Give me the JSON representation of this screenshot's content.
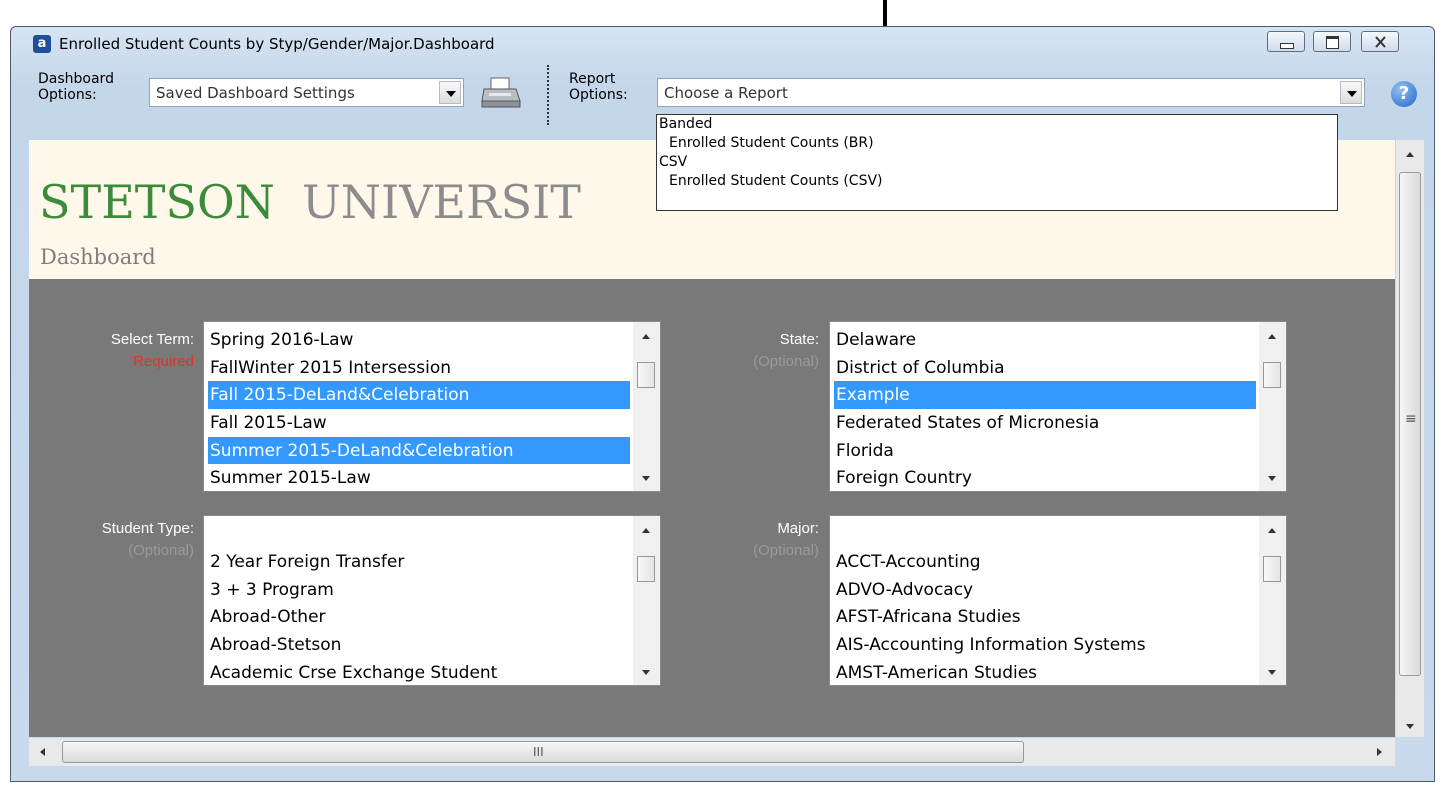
{
  "window": {
    "app_icon_letter": "a",
    "title": "Enrolled Student Counts by Styp/Gender/Major.Dashboard",
    "controls": [
      "minimize-icon",
      "restore-icon",
      "close-icon"
    ]
  },
  "toolbar": {
    "dashboard_options_label": "Dashboard\nOptions:",
    "dashboard_options_value": "Saved Dashboard Settings",
    "print_icon": "printer-icon",
    "report_options_label": "Report\nOptions:",
    "report_options_value": "Choose a Report",
    "help_icon": "help-icon",
    "help_glyph": "?"
  },
  "report_dropdown": {
    "groups": [
      {
        "label": "Banded",
        "items": [
          "Enrolled Student Counts (BR)"
        ]
      },
      {
        "label": "CSV",
        "items": [
          "Enrolled Student Counts (CSV)"
        ]
      }
    ]
  },
  "banner": {
    "name_part1": "STETSON",
    "name_part2": "UNIVERSIT",
    "subtitle": "Dashboard",
    "colors": {
      "green": "#3b8b3b",
      "gray": "#8c8c8c"
    }
  },
  "filters": {
    "term": {
      "label": "Select Term:",
      "note": "Required",
      "items": [
        "Spring 2016-Law",
        "FallWinter 2015 Intersession",
        "Fall 2015-DeLand&Celebration",
        "Fall 2015-Law",
        "Summer 2015-DeLand&Celebration",
        "Summer 2015-Law"
      ],
      "selected": [
        2,
        4
      ]
    },
    "state": {
      "label": "State:",
      "note": "(Optional)",
      "items": [
        "Delaware",
        "District of Columbia",
        "Example",
        "Federated States of Micronesia",
        "Florida",
        "Foreign Country"
      ],
      "selected": [
        2
      ]
    },
    "student_type": {
      "label": "Student Type:",
      "note": "(Optional)",
      "items": [
        "",
        "2 Year Foreign Transfer",
        "3 + 3 Program",
        "Abroad-Other",
        "Abroad-Stetson",
        "Academic Crse Exchange Student"
      ],
      "selected": []
    },
    "major": {
      "label": "Major:",
      "note": "(Optional)",
      "items": [
        "",
        "ACCT-Accounting",
        "ADVO-Advocacy",
        "AFST-Africana Studies",
        "AIS-Accounting Information Systems",
        "AMST-American Studies"
      ],
      "selected": []
    }
  },
  "scrollbar": {
    "h_grip": "III",
    "v_grip": "≡"
  },
  "colors": {
    "selection": "#3399ff",
    "panel": "#7a7979",
    "required": "#d8362e"
  }
}
